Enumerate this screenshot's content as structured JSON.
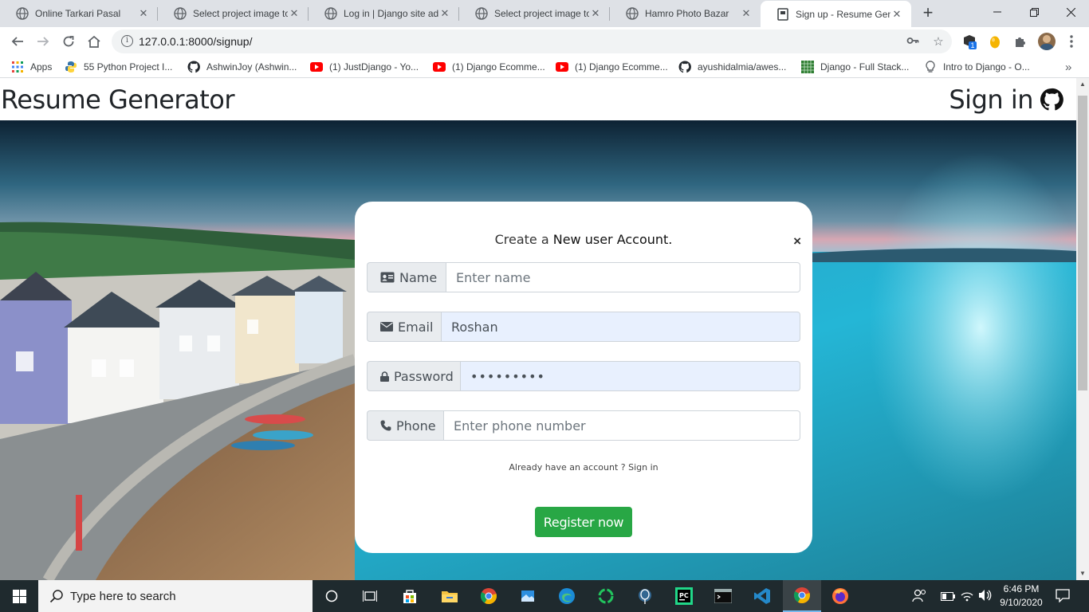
{
  "browser": {
    "tabs": [
      {
        "title": "Online Tarkari Pasal",
        "active": false
      },
      {
        "title": "Select project image to",
        "active": false
      },
      {
        "title": "Log in | Django site adm",
        "active": false
      },
      {
        "title": "Select project image to",
        "active": false
      },
      {
        "title": "Hamro Photo Bazar",
        "active": false
      },
      {
        "title": "Sign up - Resume Gene",
        "active": true
      }
    ],
    "url": "127.0.0.1:8000/signup/",
    "bookmarks": [
      "Apps",
      "55 Python Project I...",
      "AshwinJoy (Ashwin...",
      "(1) JustDjango - Yo...",
      "(1) Django Ecomme...",
      "(1) Django Ecomme...",
      "ayushidalmia/awes...",
      "Django - Full Stack...",
      "Intro to Django - O..."
    ],
    "bookmarks_overflow": "»",
    "extension_badge": "1"
  },
  "site": {
    "brand": "Resume Generator",
    "signin": "Sign in"
  },
  "form": {
    "heading_prefix": "Create a ",
    "heading_strong": "New user Account.",
    "close": "×",
    "name_label": "Name",
    "name_placeholder": "Enter name",
    "email_label": "Email",
    "email_value": "Roshan",
    "password_label": "Password",
    "password_value": "•••••••••",
    "phone_label": "Phone",
    "phone_placeholder": "Enter phone number",
    "already": "Already have an account ? Sign in",
    "register": "Register now"
  },
  "taskbar": {
    "search_placeholder": "Type here to search",
    "time": "6:46 PM",
    "date": "9/10/2020"
  },
  "colors": {
    "accent_green": "#28a745",
    "autofill_blue": "#e8f0fe",
    "taskbar": "#1f2a2e"
  }
}
